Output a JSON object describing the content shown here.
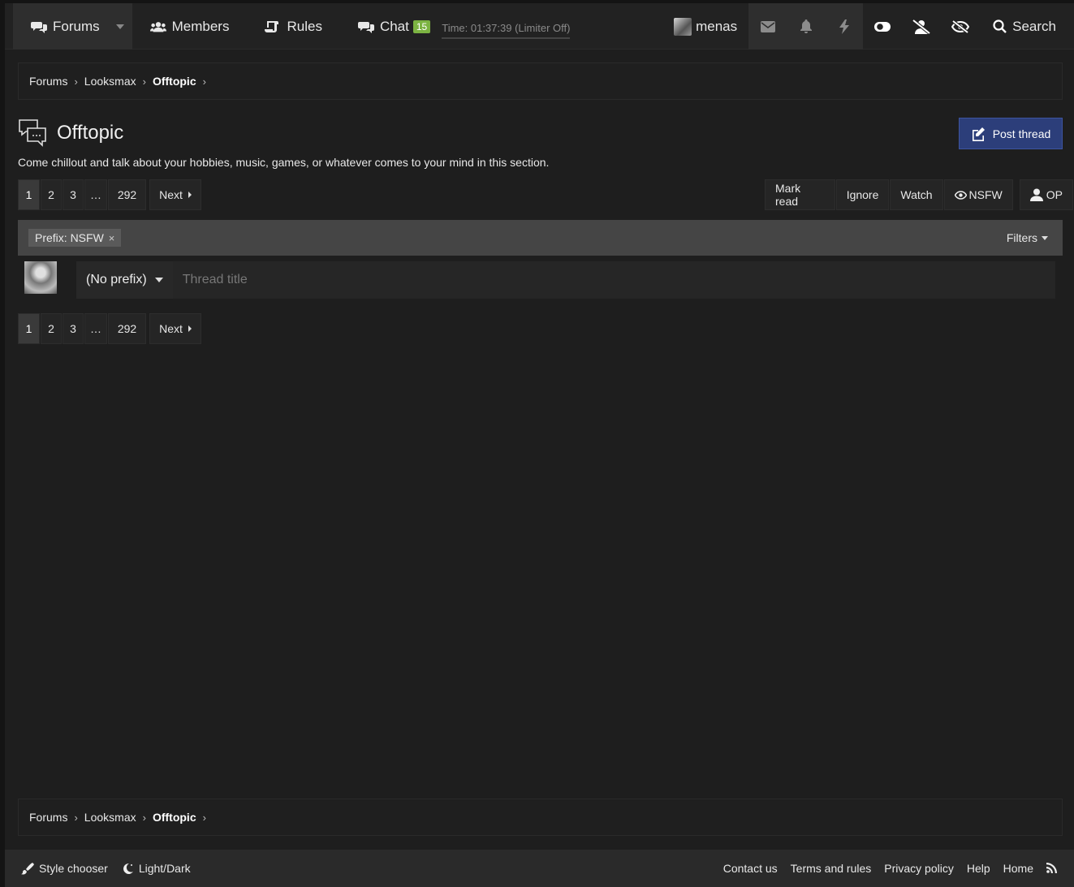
{
  "nav": {
    "forums": "Forums",
    "members": "Members",
    "rules": "Rules",
    "chat": "Chat",
    "chat_count": "15",
    "time": "Time: 01:37:39 (Limiter Off)",
    "username": "menas",
    "search": "Search",
    "icons": [
      "envelope-icon",
      "bell-icon",
      "bolt-icon",
      "toggle-icon",
      "user-slash-icon",
      "eye-slash-icon"
    ]
  },
  "breadcrumb": [
    "Forums",
    "Looksmax",
    "Offtopic"
  ],
  "page": {
    "title": "Offtopic",
    "description": "Come chillout and talk about your hobbies, music, games, or whatever comes to your mind in this section.",
    "post_thread": "Post thread"
  },
  "pagination": {
    "pages": [
      "1",
      "2",
      "3",
      "…",
      "292"
    ],
    "current": "1",
    "next": "Next"
  },
  "actions": {
    "mark_read": "Mark read",
    "ignore": "Ignore",
    "watch": "Watch",
    "nsfw": "NSFW",
    "op": "OP"
  },
  "filter": {
    "prefix_tag": "Prefix: NSFW",
    "remove": "×",
    "filters": "Filters"
  },
  "quick_thread": {
    "prefix": "(No prefix)",
    "placeholder": "Thread title"
  },
  "footer": {
    "style_chooser": "Style chooser",
    "light_dark": "Light/Dark",
    "links": [
      "Contact us",
      "Terms and rules",
      "Privacy policy",
      "Help",
      "Home"
    ]
  },
  "colors": {
    "background": "#1e1e1e",
    "nav": "#222222",
    "accent_button": "#2c3e7a",
    "chat_badge": "#7cb342",
    "filter_bar": "#454545"
  }
}
